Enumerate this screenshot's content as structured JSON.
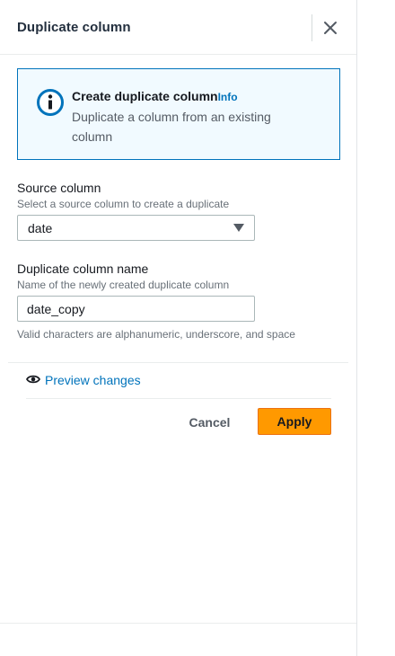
{
  "panel": {
    "title": "Duplicate column",
    "close_icon": "close-icon"
  },
  "info": {
    "icon": "info-circle-icon",
    "title": "Create duplicate column",
    "link": "Info",
    "description": "Duplicate a column from an existing column"
  },
  "source_column": {
    "label": "Source column",
    "description": "Select a source column to create a duplicate",
    "selected": "date"
  },
  "duplicate_name": {
    "label": "Duplicate column name",
    "description": "Name of the newly created duplicate column",
    "value": "date_copy",
    "hint": "Valid characters are alphanumeric, underscore, and space"
  },
  "preview": {
    "icon": "eye-icon",
    "label": "Preview changes"
  },
  "actions": {
    "cancel_label": "Cancel",
    "apply_label": "Apply"
  },
  "colors": {
    "accent": "#0073bb",
    "primary_button": "#ff9900",
    "info_background": "#f1faff"
  }
}
